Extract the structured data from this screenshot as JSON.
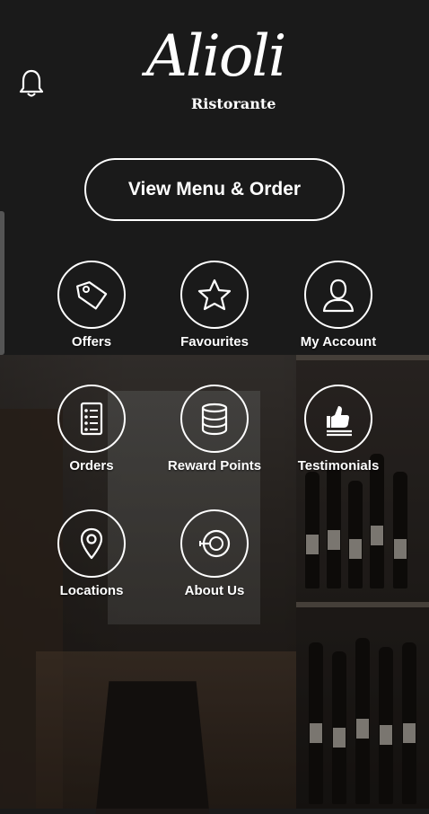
{
  "brand": {
    "name": "Alioli",
    "tagline": "Ristorante"
  },
  "header": {
    "notification_icon": "bell-icon"
  },
  "cta": {
    "label": "View Menu & Order"
  },
  "menu": [
    {
      "label": "Offers",
      "icon": "tag-icon"
    },
    {
      "label": "Favourites",
      "icon": "star-icon"
    },
    {
      "label": "My Account",
      "icon": "user-icon"
    },
    {
      "label": "Orders",
      "icon": "order-list-icon"
    },
    {
      "label": "Reward Points",
      "icon": "coin-stack-icon"
    },
    {
      "label": "Testimonials",
      "icon": "thumbs-up-icon"
    },
    {
      "label": "Locations",
      "icon": "map-pin-icon"
    },
    {
      "label": "About Us",
      "icon": "dining-plate-icon"
    }
  ],
  "colors": {
    "background": "#1a1a1a",
    "foreground": "#ffffff"
  }
}
